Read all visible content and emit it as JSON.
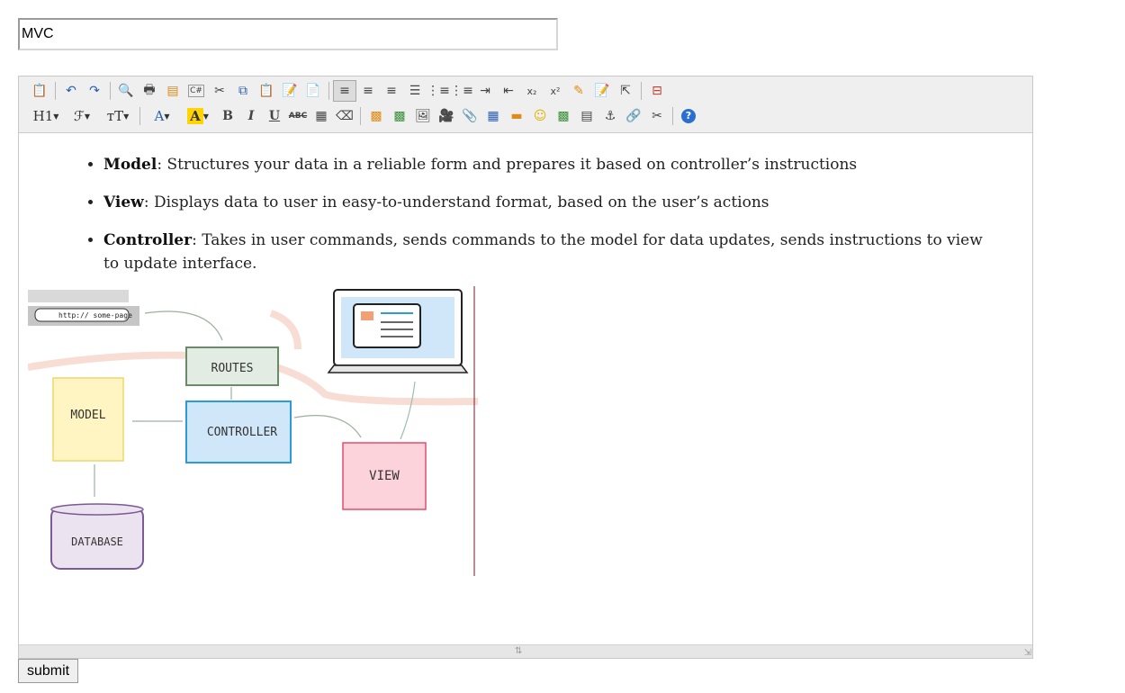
{
  "form": {
    "title_value": "MVC",
    "submit_label": "submit"
  },
  "toolbar": {
    "heading_label": "H1",
    "font_label": "ℱ",
    "size_label": "ᴛT",
    "bold_label": "B",
    "italic_label": "I",
    "underline_label": "U",
    "strike_label": "ABC",
    "source_label": "C#",
    "font_color_label": "A",
    "highlight_label": "A",
    "help_label": "?"
  },
  "content": {
    "items": [
      {
        "term": "Model",
        "text": ": Structures your data in a reliable form and prepares it based on controller’s instructions"
      },
      {
        "term": "View",
        "text": ": Displays data to user in easy-to-understand format, based on the user’s actions"
      },
      {
        "term": "Controller",
        "text": ": Takes in user commands, sends commands to the model for data updates, sends instructions to view to update interface."
      }
    ],
    "diagram": {
      "url_text": "http:// some-page",
      "routes": "ROUTES",
      "model": "MODEL",
      "controller": "CONTROLLER",
      "view": "VIEW",
      "database": "DATABASE"
    }
  },
  "colors": {
    "routes": "#e3ece3",
    "model": "#fff5c2",
    "controller": "#cfe7f8",
    "view": "#fcd3db",
    "database": "#ece3f1"
  }
}
